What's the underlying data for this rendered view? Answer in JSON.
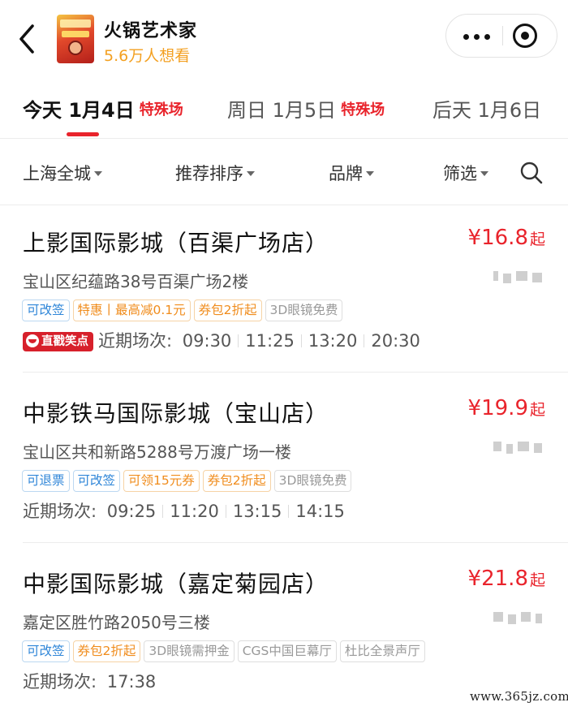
{
  "header": {
    "title": "火锅艺术家",
    "subtitle": "5.6万人想看",
    "back_icon": "chevron-left-icon",
    "menu_icon": "more-dots-icon",
    "close_icon": "target-circle-icon"
  },
  "date_tabs": [
    {
      "label": "今天 1月4日",
      "tag": "特殊场",
      "active": true
    },
    {
      "label": "周日 1月5日",
      "tag": "特殊场",
      "active": false
    },
    {
      "label": "后天 1月6日",
      "tag": "",
      "active": false
    }
  ],
  "filters": [
    {
      "label": "上海全城"
    },
    {
      "label": "推荐排序"
    },
    {
      "label": "品牌"
    },
    {
      "label": "筛选"
    }
  ],
  "search_icon": "search-icon",
  "cinemas": [
    {
      "name": "上影国际影城（百渠广场店）",
      "price": "¥16.8",
      "price_suffix": "起",
      "address": "宝山区纪蕴路38号百渠广场2楼",
      "tags": [
        {
          "text": "可改签",
          "style": "blue"
        },
        {
          "text": "特惠丨最高减0.1元",
          "style": "orange"
        },
        {
          "text": "券包2折起",
          "style": "orange"
        },
        {
          "text": "3D眼镜免费",
          "style": "gray"
        }
      ],
      "badge": "直戳笑点",
      "shows_label": "近期场次:",
      "times": [
        "09:30",
        "11:25",
        "13:20",
        "20:30"
      ]
    },
    {
      "name": "中影铁马国际影城（宝山店）",
      "price": "¥19.9",
      "price_suffix": "起",
      "address": "宝山区共和新路5288号万渡广场一楼",
      "tags": [
        {
          "text": "可退票",
          "style": "blue"
        },
        {
          "text": "可改签",
          "style": "blue"
        },
        {
          "text": "可领15元券",
          "style": "orange"
        },
        {
          "text": "券包2折起",
          "style": "orange"
        },
        {
          "text": "3D眼镜免费",
          "style": "gray"
        }
      ],
      "badge": "",
      "shows_label": "近期场次:",
      "times": [
        "09:25",
        "11:20",
        "13:15",
        "14:15"
      ]
    },
    {
      "name": "中影国际影城（嘉定菊园店）",
      "price": "¥21.8",
      "price_suffix": "起",
      "address": "嘉定区胜竹路2050号三楼",
      "tags": [
        {
          "text": "可改签",
          "style": "blue"
        },
        {
          "text": "券包2折起",
          "style": "orange"
        },
        {
          "text": "3D眼镜需押金",
          "style": "gray"
        },
        {
          "text": "CGS中国巨幕厅",
          "style": "gray"
        },
        {
          "text": "杜比全景声厅",
          "style": "gray"
        }
      ],
      "badge": "",
      "shows_label": "近期场次:",
      "times": [
        "17:38"
      ]
    }
  ],
  "watermark": "www.365jz.com",
  "colors": {
    "accent_red": "#e9242c",
    "subtitle_orange": "#f3a021",
    "tag_blue": "#2f86d8",
    "tag_orange": "#f08c1c"
  }
}
